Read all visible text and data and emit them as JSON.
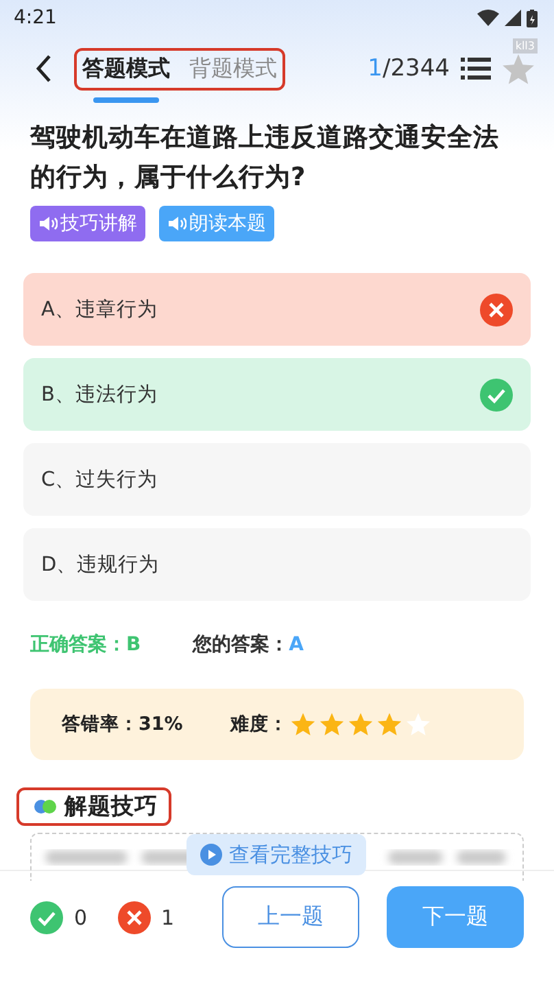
{
  "status_bar": {
    "time": "4:21"
  },
  "header": {
    "modes": [
      {
        "label": "答题模式",
        "selected": true
      },
      {
        "label": "背题模式",
        "selected": false
      }
    ],
    "current": "1",
    "total": "/2344",
    "badge": "kll3",
    "favorite": false
  },
  "question": {
    "text": "驾驶机动车在道路上违反道路交通安全法的行为，属于什么行为?",
    "audio_buttons": [
      {
        "label": "技巧讲解",
        "color": "#8f6cf0"
      },
      {
        "label": "朗读本题",
        "color": "#4aa6f8"
      }
    ]
  },
  "options": [
    {
      "label": "A、违章行为",
      "kind": "wrong"
    },
    {
      "label": "B、违法行为",
      "kind": "correct"
    },
    {
      "label": "C、过失行为",
      "kind": "plain"
    },
    {
      "label": "D、违规行为",
      "kind": "plain"
    }
  ],
  "answers": {
    "correct_label": "正确答案：",
    "correct": "B",
    "yours_label": "您的答案：",
    "yours": "A"
  },
  "stats": {
    "error_rate_label": "答错率：",
    "error_rate": "31%",
    "difficulty_label": "难度：",
    "stars": 4
  },
  "tips": {
    "title": "解题技巧",
    "view_full": "查看完整技巧"
  },
  "footer": {
    "right_count": "0",
    "wrong_count": "1",
    "prev": "上一题",
    "next": "下一题"
  }
}
